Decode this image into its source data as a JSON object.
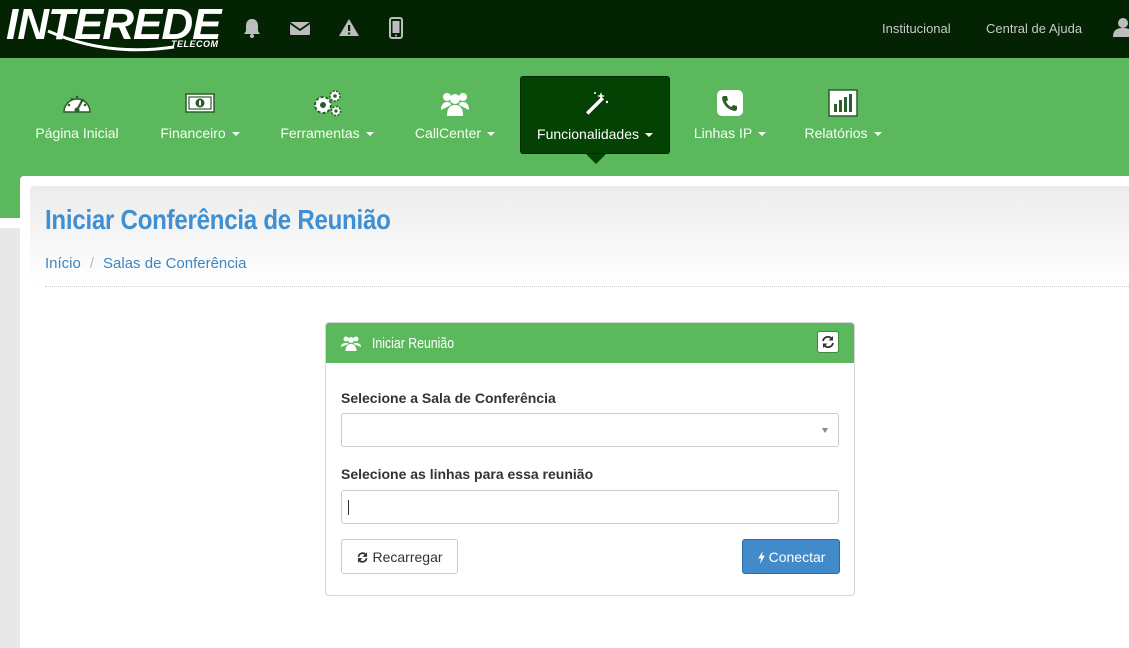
{
  "brand": {
    "name": "INTEREDE",
    "sub": "TELECOM"
  },
  "topbar": {
    "icons": [
      "bell-icon",
      "envelope-icon",
      "warning-icon",
      "mobile-icon"
    ],
    "links": [
      "Institucional",
      "Central de Ajuda"
    ],
    "user_icon": "user-icon"
  },
  "nav": {
    "items": [
      {
        "label": "Página Inicial",
        "icon": "dashboard-icon",
        "dropdown": false
      },
      {
        "label": "Financeiro",
        "icon": "money-icon",
        "dropdown": true
      },
      {
        "label": "Ferramentas",
        "icon": "gears-icon",
        "dropdown": true
      },
      {
        "label": "CallCenter",
        "icon": "users-icon",
        "dropdown": true
      },
      {
        "label": "Funcionalidades",
        "icon": "magic-wand-icon",
        "dropdown": true,
        "active": true
      },
      {
        "label": "Linhas IP",
        "icon": "phone-icon",
        "dropdown": true
      },
      {
        "label": "Relatórios",
        "icon": "bar-chart-icon",
        "dropdown": true
      }
    ]
  },
  "page": {
    "title": "Iniciar Conferência de Reunião",
    "breadcrumb": [
      "Início",
      "Salas de Conferência"
    ]
  },
  "card": {
    "title": "Iniciar Reunião",
    "room_label": "Selecione a Sala de Conferência",
    "room_value": "",
    "lines_label": "Selecione as linhas para essa reunião",
    "lines_value": "",
    "reload_label": "Recarregar",
    "connect_label": "Conectar"
  },
  "colors": {
    "topbar": "#032303",
    "nav": "#5cb85c",
    "nav_active": "#034203",
    "title": "#3f8fd2",
    "primary": "#428bca"
  }
}
